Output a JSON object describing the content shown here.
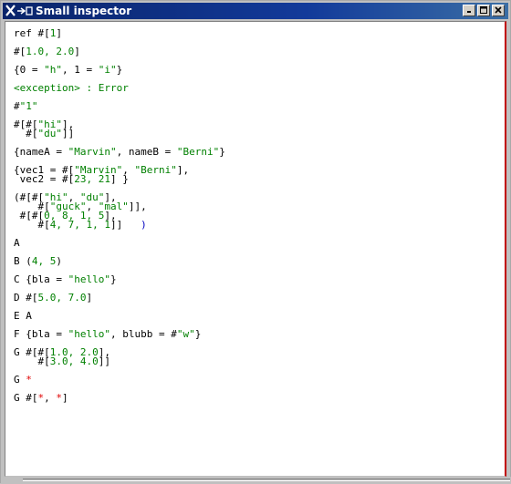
{
  "window": {
    "title": "Small inspector",
    "wm_icon_text": "X",
    "buttons": [
      "minimize",
      "maximize",
      "close"
    ]
  },
  "lines": [
    {
      "id": "l1",
      "parts": [
        {
          "t": "ref #[",
          "c": "k"
        },
        {
          "t": "1",
          "c": "g"
        },
        {
          "t": "]",
          "c": "k"
        }
      ]
    },
    {
      "id": "l2",
      "parts": [
        {
          "t": "#[",
          "c": "k"
        },
        {
          "t": "1.0, 2.0",
          "c": "g"
        },
        {
          "t": "]",
          "c": "k"
        }
      ]
    },
    {
      "id": "l3",
      "parts": [
        {
          "t": "{0 = ",
          "c": "k"
        },
        {
          "t": "\"h\"",
          "c": "g"
        },
        {
          "t": ", 1 = ",
          "c": "k"
        },
        {
          "t": "\"i\"",
          "c": "g"
        },
        {
          "t": "}",
          "c": "k"
        }
      ]
    },
    {
      "id": "l4",
      "parts": [
        {
          "t": "<exception> : Error",
          "c": "g"
        }
      ]
    },
    {
      "id": "l5",
      "parts": [
        {
          "t": "#",
          "c": "k"
        },
        {
          "t": "\"1\"",
          "c": "g"
        }
      ]
    },
    {
      "id": "l6",
      "parts": [
        {
          "t": "#[#[",
          "c": "k"
        },
        {
          "t": "\"hi\"",
          "c": "g"
        },
        {
          "t": "],",
          "c": "k"
        }
      ]
    },
    {
      "id": "l7",
      "parts": [
        {
          "t": "  #[",
          "c": "k"
        },
        {
          "t": "\"du\"",
          "c": "g"
        },
        {
          "t": "]]",
          "c": "k"
        }
      ]
    },
    {
      "id": "l8",
      "parts": [
        {
          "t": "{nameA = ",
          "c": "k"
        },
        {
          "t": "\"Marvin\"",
          "c": "g"
        },
        {
          "t": ", nameB = ",
          "c": "k"
        },
        {
          "t": "\"Berni\"",
          "c": "g"
        },
        {
          "t": "}",
          "c": "k"
        }
      ]
    },
    {
      "id": "l9",
      "parts": [
        {
          "t": "{vec1 = #[",
          "c": "k"
        },
        {
          "t": "\"Marvin\"",
          "c": "g"
        },
        {
          "t": ", ",
          "c": "k"
        },
        {
          "t": "\"Berni\"",
          "c": "g"
        },
        {
          "t": "],",
          "c": "k"
        }
      ]
    },
    {
      "id": "l10",
      "parts": [
        {
          "t": " vec2 = #[",
          "c": "k"
        },
        {
          "t": "23, 21",
          "c": "g"
        },
        {
          "t": "] }",
          "c": "k"
        }
      ]
    },
    {
      "id": "l11",
      "parts": [
        {
          "t": "(#[#[",
          "c": "k"
        },
        {
          "t": "\"hi\"",
          "c": "g"
        },
        {
          "t": ", ",
          "c": "k"
        },
        {
          "t": "\"du\"",
          "c": "g"
        },
        {
          "t": "],",
          "c": "k"
        }
      ]
    },
    {
      "id": "l12",
      "parts": [
        {
          "t": "    #[",
          "c": "k"
        },
        {
          "t": "\"guck\"",
          "c": "g"
        },
        {
          "t": ", ",
          "c": "k"
        },
        {
          "t": "\"mal\"",
          "c": "g"
        },
        {
          "t": "]],",
          "c": "k"
        }
      ]
    },
    {
      "id": "l13",
      "parts": [
        {
          "t": " #[#[",
          "c": "k"
        },
        {
          "t": "0, 8, 1, 5",
          "c": "g"
        },
        {
          "t": "],",
          "c": "k"
        }
      ]
    },
    {
      "id": "l14",
      "parts": [
        {
          "t": "    #[",
          "c": "k"
        },
        {
          "t": "4, 7, 1, 1",
          "c": "g"
        },
        {
          "t": "]]   ",
          "c": "k"
        },
        {
          "t": ")",
          "c": "b"
        }
      ]
    },
    {
      "id": "l15",
      "parts": [
        {
          "t": "A",
          "c": "k"
        }
      ]
    },
    {
      "id": "l16",
      "parts": [
        {
          "t": "B (",
          "c": "k"
        },
        {
          "t": "4, 5",
          "c": "g"
        },
        {
          "t": ")",
          "c": "k"
        }
      ]
    },
    {
      "id": "l17",
      "parts": [
        {
          "t": "C {bla = ",
          "c": "k"
        },
        {
          "t": "\"hello\"",
          "c": "g"
        },
        {
          "t": "}",
          "c": "k"
        }
      ]
    },
    {
      "id": "l18",
      "parts": [
        {
          "t": "D #[",
          "c": "k"
        },
        {
          "t": "5.0, 7.0",
          "c": "g"
        },
        {
          "t": "]",
          "c": "k"
        }
      ]
    },
    {
      "id": "l19",
      "parts": [
        {
          "t": "E A",
          "c": "k"
        }
      ]
    },
    {
      "id": "l20",
      "parts": [
        {
          "t": "F {bla = ",
          "c": "k"
        },
        {
          "t": "\"hello\"",
          "c": "g"
        },
        {
          "t": ", blubb = #",
          "c": "k"
        },
        {
          "t": "\"w\"",
          "c": "g"
        },
        {
          "t": "}",
          "c": "k"
        }
      ]
    },
    {
      "id": "l21",
      "parts": [
        {
          "t": "G #[#[",
          "c": "k"
        },
        {
          "t": "1.0, 2.0",
          "c": "g"
        },
        {
          "t": "],",
          "c": "k"
        }
      ]
    },
    {
      "id": "l22",
      "parts": [
        {
          "t": "    #[",
          "c": "k"
        },
        {
          "t": "3.0, 4.0",
          "c": "g"
        },
        {
          "t": "]]",
          "c": "k"
        }
      ]
    },
    {
      "id": "l23",
      "parts": [
        {
          "t": "G ",
          "c": "k"
        },
        {
          "t": "*",
          "c": "r"
        }
      ]
    },
    {
      "id": "l24",
      "parts": [
        {
          "t": "G #[",
          "c": "k"
        },
        {
          "t": "*",
          "c": "r"
        },
        {
          "t": ", ",
          "c": "k"
        },
        {
          "t": "*",
          "c": "r"
        },
        {
          "t": "]",
          "c": "k"
        }
      ]
    }
  ],
  "colors": {
    "keyword": "#000000",
    "literal": "#008000",
    "error": "#e00000",
    "paren": "#0000c0",
    "titlebar": "#0a246a"
  }
}
